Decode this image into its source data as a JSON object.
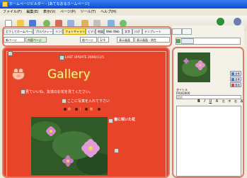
{
  "window": {
    "title": "ホームページビルダー - [あてなおるホームページ]",
    "menu": [
      "ファイル(F)",
      "編集(E)",
      "表示(V)",
      "ページ(P)",
      "ツール(T)",
      "ヘルプ(H)"
    ],
    "right_buttons": [
      {
        "label": "Alpha.com",
        "icon": "globe-icon",
        "color": "#2f8f3a"
      },
      {
        "label": "終了",
        "icon": "exit-icon",
        "color": "#6a7fb0"
      }
    ]
  },
  "toolbar": {
    "icons": [
      {
        "name": "new-page-icon",
        "color": "#ffffff"
      },
      {
        "name": "open-icon",
        "color": "#f2c94c"
      },
      {
        "name": "save-icon",
        "color": "#4c78d8"
      },
      {
        "name": "undo-icon",
        "color": "#79b85c"
      },
      {
        "name": "cut-icon",
        "color": "#d46a5a"
      },
      {
        "name": "copy-icon",
        "color": "#9bb0e0"
      },
      {
        "name": "paste-icon",
        "color": "#e0b060"
      },
      {
        "name": "table-icon",
        "color": "#c0c0c0"
      },
      {
        "name": "image-icon",
        "color": "#7fb3e6"
      },
      {
        "name": "link-icon",
        "color": "#6fbf6f"
      }
    ]
  },
  "tabs": [
    "どうしてホームページ",
    "プロパティー",
    "リンク",
    "フォトギャラリー",
    "ビデオ",
    "地図",
    "Web Web",
    "文字",
    "ログ",
    "テンプレート"
  ],
  "active_tab": "フォトギャラリー",
  "controls": {
    "mode_a": "新ページ",
    "mode_b": "内容ページ",
    "prev": "前ページ",
    "zoom": "1/ 9",
    "opt_a": "表示画面",
    "opt_b": "表示画面 - 再生"
  },
  "editor": {
    "last_update": "LAST UPDATE  2000/11/5",
    "heading": "Gallery",
    "line1": "見ていいね、友達のお花を見てください。",
    "line2": "ここに写真を入れて下さい",
    "nav": [
      "前",
      "|",
      "後"
    ],
    "caption": "春に咲いた花",
    "colors": {
      "background": "#e8442a",
      "heading": "#ffe9a0"
    }
  },
  "side_panel": {
    "buttons": [
      "全体",
      "全体",
      "追加"
    ],
    "field_label": "タイトル",
    "field_value": "FRUI2000",
    "comment_label": "説明",
    "format_tools": [
      "B",
      "I",
      "U",
      "A",
      "左",
      "中",
      "右",
      "表"
    ]
  }
}
